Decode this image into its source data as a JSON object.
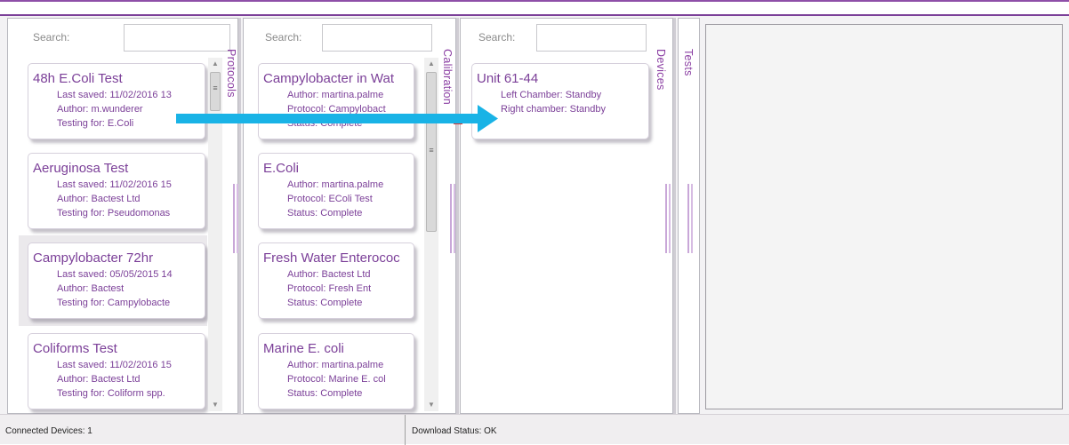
{
  "protocols_panel": {
    "search_label": "Search:",
    "tab_label": "Protocols",
    "cards": [
      {
        "title": "48h E.Coli Test",
        "lines": [
          "Last saved:  11/02/2016 13",
          "Author:  m.wunderer",
          "Testing for:  E.Coli"
        ]
      },
      {
        "title": "Aeruginosa Test",
        "lines": [
          "Last saved:  11/02/2016 15",
          "Author:  Bactest Ltd",
          "Testing for:  Pseudomonas"
        ]
      },
      {
        "title": "Campylobacter 72hr",
        "lines": [
          "Last saved:  05/05/2015 14",
          "Author:  Bactest",
          "Testing for:  Campylobacte"
        ]
      },
      {
        "title": "Coliforms Test",
        "lines": [
          "Last saved:  11/02/2016 15",
          "Author:  Bactest Ltd",
          "Testing for:  Coliform spp."
        ]
      }
    ]
  },
  "calibration_panel": {
    "search_label": "Search:",
    "tab_label": "Calibration",
    "cards": [
      {
        "title": "Campylobacter in Wat",
        "lines": [
          "Author:  martina.palme",
          "Protocol:  Campylobact",
          "Status:  Complete"
        ]
      },
      {
        "title": "E.Coli",
        "lines": [
          "Author:  martina.palme",
          "Protocol:  EColi Test",
          "Status:  Complete"
        ]
      },
      {
        "title": "Fresh Water Enterococ",
        "lines": [
          "Author:  Bactest Ltd",
          "Protocol:  Fresh Ent",
          "Status:  Complete"
        ]
      },
      {
        "title": "Marine E. coli",
        "lines": [
          "Author:  martina.palme",
          "Protocol:  Marine E. col",
          "Status:  Complete"
        ]
      }
    ]
  },
  "devices_panel": {
    "search_label": "Search:",
    "tab_label": "Devices",
    "cards": [
      {
        "title": "Unit 61-44",
        "lines": [
          "Left Chamber:  Standby",
          "Right chamber:  Standby"
        ]
      }
    ]
  },
  "tests_panel": {
    "tab_label": "Tests"
  },
  "status_bar": {
    "connected_devices": "Connected Devices:  1",
    "download_status": "Download Status:  OK"
  },
  "colors": {
    "accent": "#7b3f98",
    "arrow": "#19b3e6"
  },
  "icons": {
    "scroll_up": "triangle-up",
    "scroll_down": "triangle-down",
    "thumb_grip": "three-lines"
  }
}
